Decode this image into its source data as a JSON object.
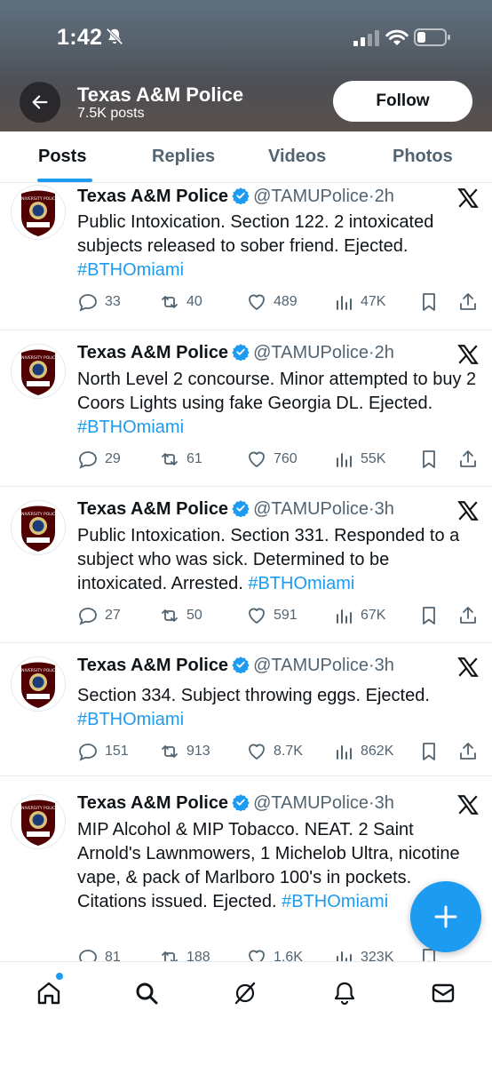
{
  "status_bar": {
    "time": "1:42"
  },
  "profile": {
    "name": "Texas A&M Police",
    "post_count": "7.5K posts",
    "follow_label": "Follow"
  },
  "tabs": [
    {
      "label": "Posts",
      "active": true
    },
    {
      "label": "Replies",
      "active": false
    },
    {
      "label": "Videos",
      "active": false
    },
    {
      "label": "Photos",
      "active": false
    }
  ],
  "tweets": [
    {
      "name": "Texas A&M Police",
      "handle": "@TAMUPolice",
      "time": "·2h",
      "text": "Public Intoxication. Section 122. 2 intoxicated subjects released to sober friend. Ejected.",
      "hashtag": "#BTHOmiami",
      "replies": "33",
      "reposts": "40",
      "likes": "489",
      "views": "47K"
    },
    {
      "name": "Texas A&M Police",
      "handle": "@TAMUPolice",
      "time": "·2h",
      "text": "North Level 2 concourse. Minor attempted to buy 2 Coors Lights using fake Georgia DL. Ejected.",
      "hashtag": "#BTHOmiami",
      "replies": "29",
      "reposts": "61",
      "likes": "760",
      "views": "55K"
    },
    {
      "name": "Texas A&M Police",
      "handle": "@TAMUPolice",
      "time": "·3h",
      "text": "Public Intoxication. Section 331. Responded to a subject who was sick. Determined to be intoxicated. Arrested.",
      "hashtag": "#BTHOmiami",
      "replies": "27",
      "reposts": "50",
      "likes": "591",
      "views": "67K"
    },
    {
      "name": "Texas A&M Police",
      "handle": "@TAMUPolice",
      "time": "·3h",
      "text": "Section 334. Subject throwing eggs. Ejected.",
      "hashtag": "#BTHOmiami",
      "replies": "151",
      "reposts": "913",
      "likes": "8.7K",
      "views": "862K"
    },
    {
      "name": "Texas A&M Police",
      "handle": "@TAMUPolice",
      "time": "·3h",
      "text": "MIP Alcohol & MIP Tobacco. NEAT. 2 Saint Arnold's Lawnmowers, 1 Michelob Ultra, nicotine vape, & pack of Marlboro 100's in pockets.  Citations issued. Ejected.",
      "hashtag": "#BTHOmiami",
      "replies": "81",
      "reposts": "188",
      "likes": "1.6K",
      "views": "323K"
    }
  ],
  "avatar_text": "UNIVERSITY POLICE",
  "colors": {
    "accent": "#1d9bf0",
    "text": "#0f1419",
    "muted": "#536471",
    "badge_maroon": "#500000"
  },
  "bottom_nav": [
    "home-icon",
    "search-icon",
    "grok-icon",
    "notifications-icon",
    "messages-icon"
  ]
}
